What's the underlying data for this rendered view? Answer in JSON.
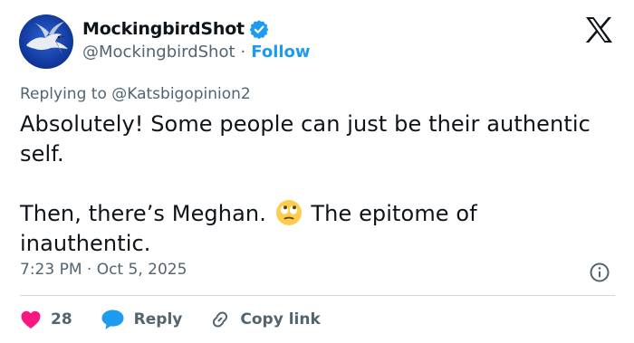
{
  "user": {
    "display_name": "MockingbirdShot",
    "handle": "@MockingbirdShot",
    "separator": "·",
    "follow_label": "Follow"
  },
  "reply_to": {
    "prefix": "Replying to",
    "mention": "@Katsbigopinion2"
  },
  "tweet": {
    "line1": "Absolutely! Some people can just be their authentic self.",
    "line2_before_emoji": "Then, there’s Meghan.",
    "emoji": "face-with-rolling-eyes",
    "line2_after_emoji": "The epitome of inauthentic."
  },
  "meta": {
    "timestamp": "7:23 PM · Oct 5, 2025"
  },
  "actions": {
    "like_count": "28",
    "reply_label": "Reply",
    "copy_label": "Copy link"
  },
  "colors": {
    "accent": "#1d9bf0",
    "like": "#f91880",
    "secondary_text": "#536471",
    "divider": "#cfd9de"
  }
}
